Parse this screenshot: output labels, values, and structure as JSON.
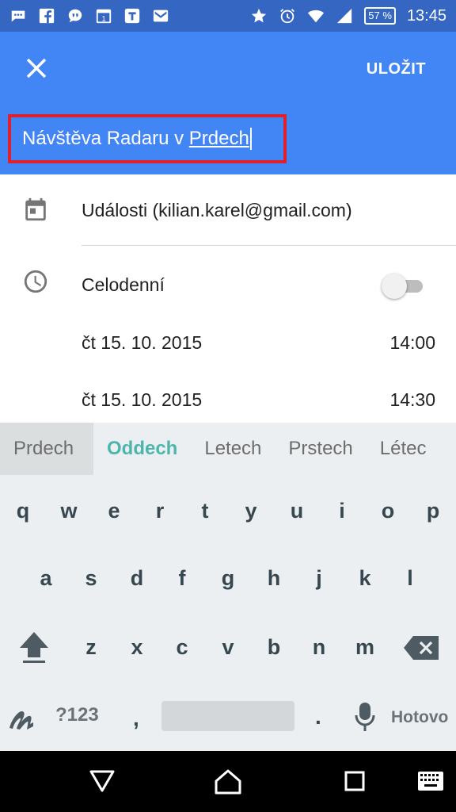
{
  "status_bar": {
    "battery": "57 %",
    "time": "13:45",
    "left_icons": [
      "messenger-icon",
      "facebook-icon",
      "chat-icon",
      "calendar-1-icon",
      "tasks-icon",
      "gmail-icon"
    ],
    "right_icons": [
      "star-icon",
      "alarm-icon",
      "wifi-icon",
      "signal-icon"
    ]
  },
  "app_bar": {
    "close_icon": "close-icon",
    "save_label": "ULOŽIT",
    "title_prefix": "Návštěva Radaru v ",
    "title_composing": "Prdech",
    "background": "#4285f4",
    "highlight_border": "#e0202e"
  },
  "event": {
    "calendar_name": "Události (kilian.karel@gmail.com)",
    "all_day_label": "Celodenní",
    "all_day_on": false,
    "start_date": "čt 15. 10. 2015",
    "start_time": "14:00",
    "end_date": "čt 15. 10. 2015",
    "end_time": "14:30"
  },
  "suggestions": [
    "Prdech",
    "Oddech",
    "Letech",
    "Prstech",
    "Létec"
  ],
  "keyboard": {
    "row1": [
      "q",
      "w",
      "e",
      "r",
      "t",
      "y",
      "u",
      "i",
      "o",
      "p"
    ],
    "row2": [
      "a",
      "s",
      "d",
      "f",
      "g",
      "h",
      "j",
      "k",
      "l"
    ],
    "row3": [
      "z",
      "x",
      "c",
      "v",
      "b",
      "n",
      "m"
    ],
    "symbols_label": "?123",
    "comma": ",",
    "period": ".",
    "done_label": "Hotovo",
    "accent_color": "#4db6ac"
  }
}
